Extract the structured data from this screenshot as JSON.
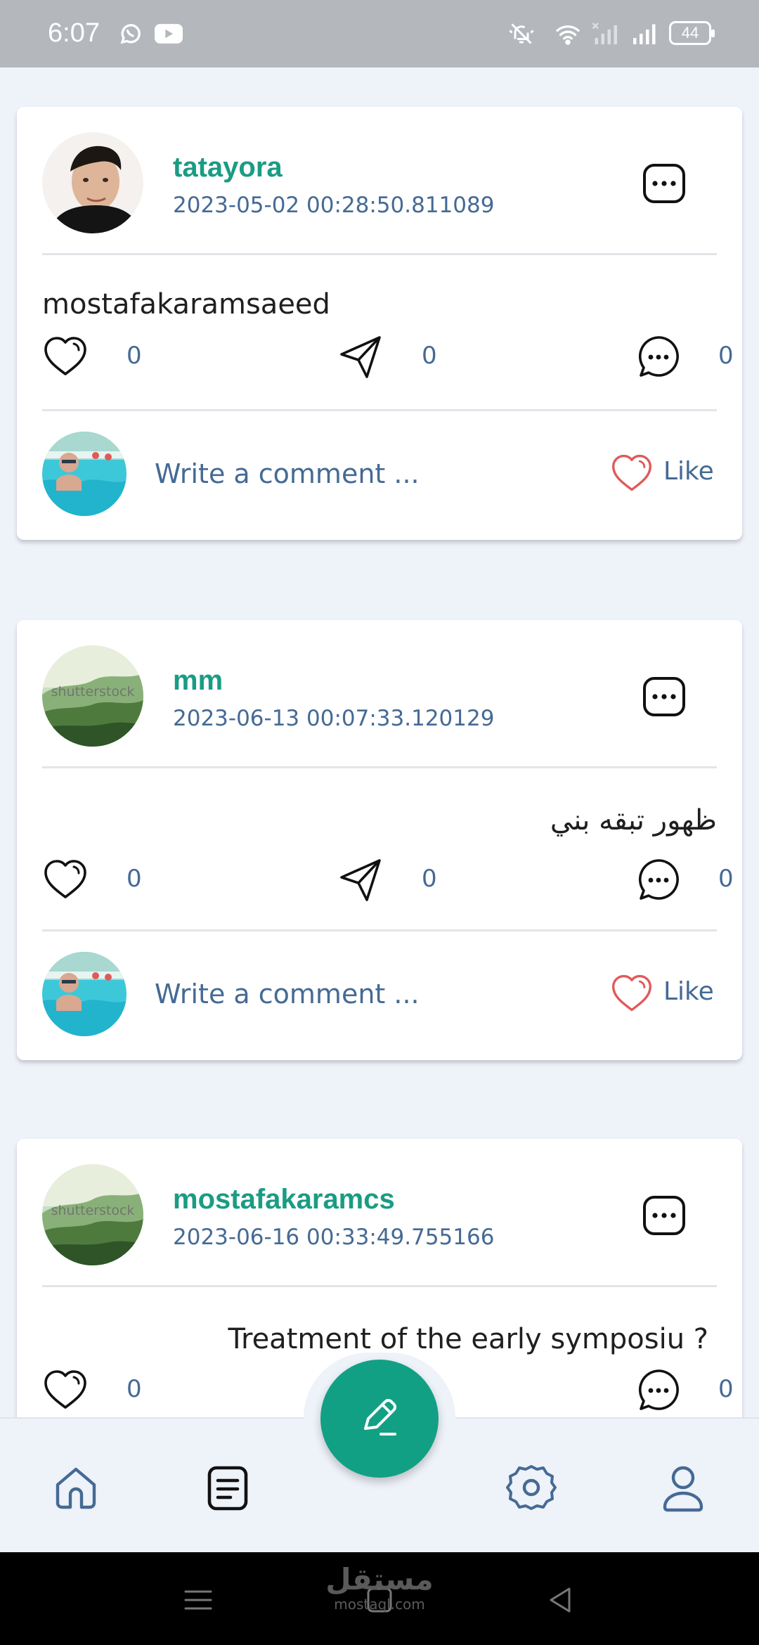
{
  "status_bar": {
    "time": "6:07",
    "battery": "44",
    "icons": [
      "whatsapp-icon",
      "youtube-icon",
      "mute-icon",
      "wifi-icon",
      "sim-no-signal-icon",
      "cell-signal-icon",
      "battery-icon"
    ]
  },
  "feed": {
    "posts": [
      {
        "username": "tatayora",
        "timestamp": "2023-05-02 00:28:50.811089",
        "text": "mostafakaramsaeed",
        "direction": "ltr",
        "likes": "0",
        "shares": "0",
        "comments": "0",
        "comment_placeholder": "Write a comment ...",
        "like_label": "Like"
      },
      {
        "username": "mm",
        "timestamp": "2023-06-13 00:07:33.120129",
        "avatar_watermark": "shutterstock",
        "text": "ظهور تبقه بني",
        "direction": "rtl",
        "likes": "0",
        "shares": "0",
        "comments": "0",
        "comment_placeholder": "Write a comment ...",
        "like_label": "Like"
      },
      {
        "username": "mostafakaramcs",
        "timestamp": "2023-06-16 00:33:49.755166",
        "avatar_watermark": "shutterstock",
        "text": "? Treatment of the early symposiu",
        "direction": "rtl",
        "likes": "0",
        "comments": "0"
      }
    ]
  },
  "bottom_nav": {
    "items": [
      "home-icon",
      "posts-icon",
      "settings-icon",
      "profile-icon"
    ],
    "fab_icon": "edit-icon"
  },
  "watermark": {
    "arabic": "مستقل",
    "latin": "mostaql.com"
  },
  "colors": {
    "accent": "#12a085",
    "username": "#1a9c84",
    "secondary_text": "#456a94",
    "like_heart": "#e05a5a",
    "background": "#eef2f9"
  }
}
